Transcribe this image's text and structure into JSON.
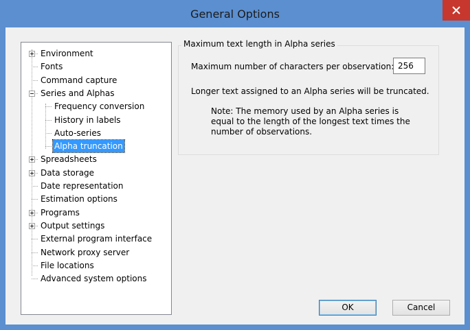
{
  "window": {
    "title": "General Options",
    "titlebar_color": "#5b8fd0",
    "close_button_color": "#c7372d"
  },
  "tree": {
    "items": [
      {
        "label": "Environment",
        "expander": "plus",
        "level": 0
      },
      {
        "label": "Fonts",
        "expander": "none",
        "level": 0
      },
      {
        "label": "Command capture",
        "expander": "none",
        "level": 0
      },
      {
        "label": "Series and Alphas",
        "expander": "minus",
        "level": 0
      },
      {
        "label": "Frequency conversion",
        "expander": "none",
        "level": 1
      },
      {
        "label": "History in labels",
        "expander": "none",
        "level": 1
      },
      {
        "label": "Auto-series",
        "expander": "none",
        "level": 1
      },
      {
        "label": "Alpha truncation",
        "expander": "none",
        "level": 1,
        "selected": true
      },
      {
        "label": "Spreadsheets",
        "expander": "plus",
        "level": 0
      },
      {
        "label": "Data storage",
        "expander": "plus",
        "level": 0
      },
      {
        "label": "Date representation",
        "expander": "none",
        "level": 0
      },
      {
        "label": "Estimation options",
        "expander": "none",
        "level": 0
      },
      {
        "label": "Programs",
        "expander": "plus",
        "level": 0
      },
      {
        "label": "Output settings",
        "expander": "plus",
        "level": 0
      },
      {
        "label": "External program interface",
        "expander": "none",
        "level": 0
      },
      {
        "label": "Network proxy server",
        "expander": "none",
        "level": 0
      },
      {
        "label": "File locations",
        "expander": "none",
        "level": 0
      },
      {
        "label": "Advanced system options",
        "expander": "none",
        "level": 0
      }
    ]
  },
  "panel": {
    "group_title": "Maximum text length in Alpha series",
    "max_chars_label": "Maximum number of characters per observation:",
    "max_chars_value": "256",
    "truncation_info": "Longer text assigned to an Alpha series will be truncated.",
    "note": "Note: The memory used by an Alpha series is equal to the length of the longest text times the number of observations."
  },
  "buttons": {
    "ok": "OK",
    "cancel": "Cancel"
  },
  "icons": {
    "close": "close-icon",
    "expand": "plus-expander-icon",
    "collapse": "minus-expander-icon"
  }
}
